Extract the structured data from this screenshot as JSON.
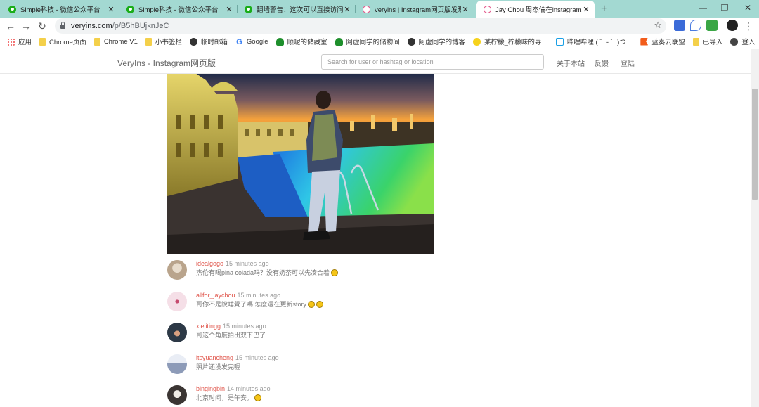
{
  "browser": {
    "tabs": [
      {
        "title": "Simple科技 - 微信公众平台",
        "favicon": "wechat-icon",
        "active": false
      },
      {
        "title": "Simple科技 - 微信公众平台",
        "favicon": "wechat-icon",
        "active": false
      },
      {
        "title": "翻墙警告：这次可以直接访问ins",
        "favicon": "wechat-icon",
        "active": false
      },
      {
        "title": "veryins | Instagram网页版发现",
        "favicon": "veryins-icon",
        "active": false
      },
      {
        "title": "Jay Chou 周杰倫在instagram发",
        "favicon": "veryins-icon",
        "active": true
      }
    ],
    "new_tab_symbol": "+",
    "window_controls": {
      "minimize": "—",
      "maximize": "❐",
      "close": "✕"
    },
    "address": {
      "host": "veryins.com",
      "path": "/p/B5hBUjknJeC"
    },
    "bookmarks": [
      {
        "label": "应用",
        "icon": "apps-icon"
      },
      {
        "label": "Chrome页面",
        "icon": "folder-icon"
      },
      {
        "label": "Chrome V1",
        "icon": "folder-icon"
      },
      {
        "label": "小书签栏",
        "icon": "folder-icon"
      },
      {
        "label": "临时邮箱",
        "icon": "globe-icon"
      },
      {
        "label": "Google",
        "icon": "google-icon"
      },
      {
        "label": "顺呢的储藏室",
        "icon": "tree-icon"
      },
      {
        "label": "阿虚同学的储物间",
        "icon": "tree-icon"
      },
      {
        "label": "阿虚同学的博客",
        "icon": "globe-icon"
      },
      {
        "label": "某柠檬_柠檬味的导…",
        "icon": "lemon-icon"
      },
      {
        "label": "哔哩哔哩 ( ゜- ゜)つ…",
        "icon": "bilibili-icon"
      },
      {
        "label": "蓝奏云联盟",
        "icon": "flag-icon"
      },
      {
        "label": "已导入",
        "icon": "folder-icon"
      },
      {
        "label": "登入",
        "icon": "avatar-icon"
      }
    ],
    "bookmarks_overflow": "»"
  },
  "site": {
    "brand": "VeryIns - Instagram网页版",
    "search_placeholder": "Search for user or hashtag or location",
    "nav": {
      "about": "关于本站",
      "feedback": "反馈",
      "login": "登陆"
    }
  },
  "comments": [
    {
      "user": "idealgogo",
      "time": "15 minutes ago",
      "text": "杰伦有喝pina colada吗？没有奶茶可以先凑合着",
      "emoji_count": 1,
      "avatar_color": "#b9a48c"
    },
    {
      "user": "allfor_jaychou",
      "time": "15 minutes ago",
      "text": "哥你不是說睡覺了嗎 怎麼還在更新story",
      "emoji_count": 2,
      "avatar_color": "#f1d7e0"
    },
    {
      "user": "xielitingg",
      "time": "15 minutes ago",
      "text": "哥这个角度拍出双下巴了",
      "emoji_count": 0,
      "avatar_color": "#2d3946"
    },
    {
      "user": "itsyuancheng",
      "time": "15 minutes ago",
      "text": "照片还没发完喔",
      "emoji_count": 0,
      "avatar_color": "#8d9bb8"
    },
    {
      "user": "bingingbin",
      "time": "14 minutes ago",
      "text": "北京时间，是午安。",
      "emoji_count": 1,
      "avatar_color": "#c9c2bc"
    }
  ]
}
